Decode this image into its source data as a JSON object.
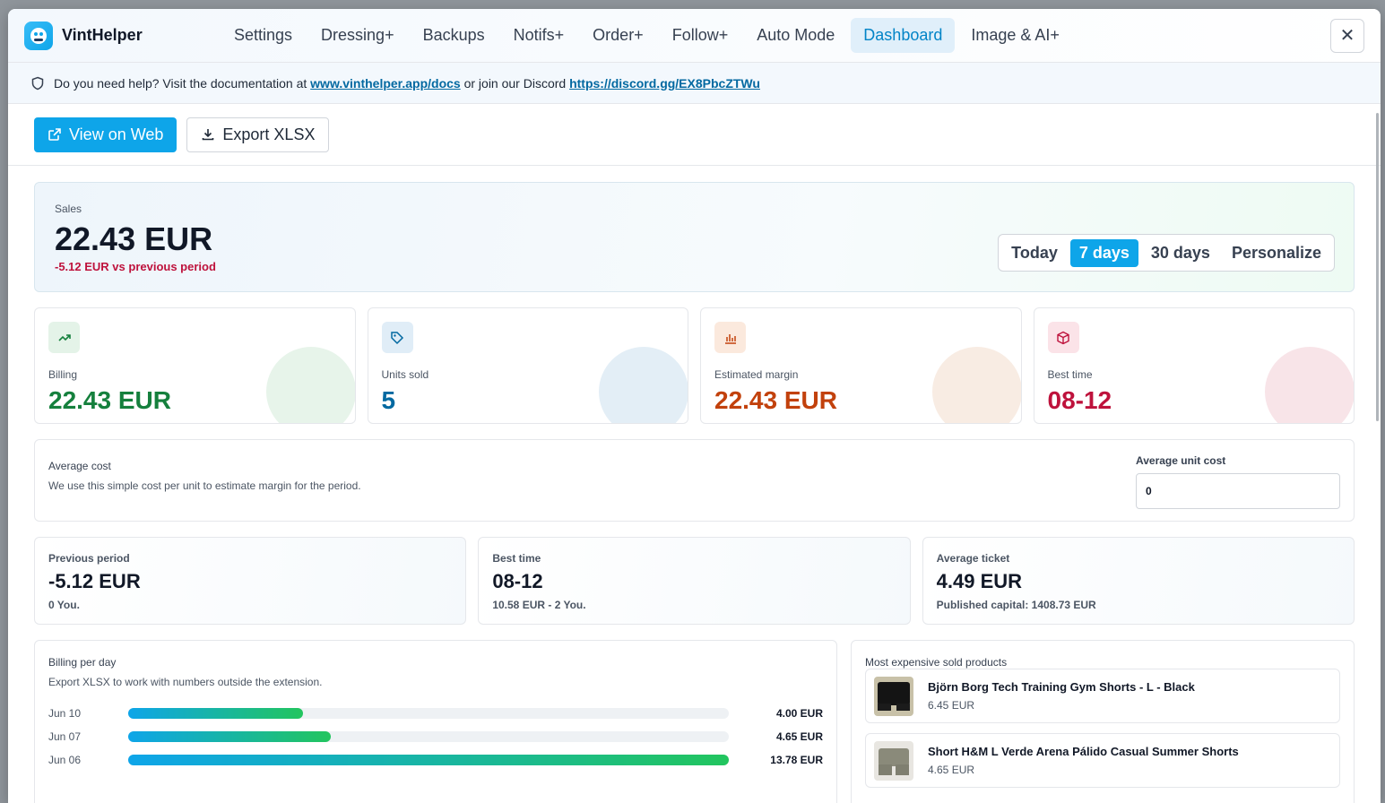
{
  "app": {
    "name": "VintHelper"
  },
  "nav": {
    "tabs": [
      {
        "label": "Settings"
      },
      {
        "label": "Dressing+"
      },
      {
        "label": "Backups"
      },
      {
        "label": "Notifs+"
      },
      {
        "label": "Order+"
      },
      {
        "label": "Follow+"
      },
      {
        "label": "Auto Mode"
      },
      {
        "label": "Dashboard",
        "active": true
      },
      {
        "label": "Image & AI+"
      }
    ],
    "close_label": "✕"
  },
  "help": {
    "prefix": "Do you need help? Visit the documentation at",
    "docs_link": "www.vinthelper.app/docs",
    "middle": "or join our Discord",
    "discord_link": "https://discord.gg/EX8PbcZTWu"
  },
  "actions": {
    "view_web": "View on Web",
    "export": "Export XLSX"
  },
  "sales": {
    "label": "Sales",
    "value": "22.43 EUR",
    "delta": "-5.12 EUR vs previous period",
    "periods": [
      "Today",
      "7 days",
      "30 days",
      "Personalize"
    ],
    "active_period": "7 days"
  },
  "kpis": [
    {
      "label": "Billing",
      "value": "22.43 EUR",
      "icon": "trending-up-icon",
      "color": "#15803d"
    },
    {
      "label": "Units sold",
      "value": "5",
      "icon": "tag-icon",
      "color": "#0369a1"
    },
    {
      "label": "Estimated margin",
      "value": "22.43 EUR",
      "icon": "bar-chart-icon",
      "color": "#c2410c"
    },
    {
      "label": "Best time",
      "value": "08-12",
      "icon": "box-icon",
      "color": "#be123c"
    }
  ],
  "average_cost": {
    "title": "Average cost",
    "description": "We use this simple cost per unit to estimate margin for the period.",
    "field_label": "Average unit cost",
    "field_value": "0"
  },
  "stats": [
    {
      "title": "Previous period",
      "value": "-5.12 EUR",
      "sub": "0 You."
    },
    {
      "title": "Best time",
      "value": "08-12",
      "sub": "10.58 EUR - 2 You."
    },
    {
      "title": "Average ticket",
      "value": "4.49 EUR",
      "sub": "Published capital: 1408.73 EUR"
    }
  ],
  "billing_per_day": {
    "title": "Billing per day",
    "description": "Export XLSX to work with numbers outside the extension.",
    "rows": [
      {
        "date": "Jun 10",
        "value": 4.0,
        "label": "4.00 EUR"
      },
      {
        "date": "Jun 07",
        "value": 4.65,
        "label": "4.65 EUR"
      },
      {
        "date": "Jun 06",
        "value": 13.78,
        "label": "13.78 EUR"
      }
    ],
    "max": 13.78
  },
  "products": {
    "title": "Most expensive sold products",
    "items": [
      {
        "name": "Björn Borg Tech Training Gym Shorts - L - Black",
        "price": "6.45 EUR"
      },
      {
        "name": "Short H&M L Verde Arena Pálido Casual Summer Shorts",
        "price": "4.65 EUR"
      }
    ]
  }
}
